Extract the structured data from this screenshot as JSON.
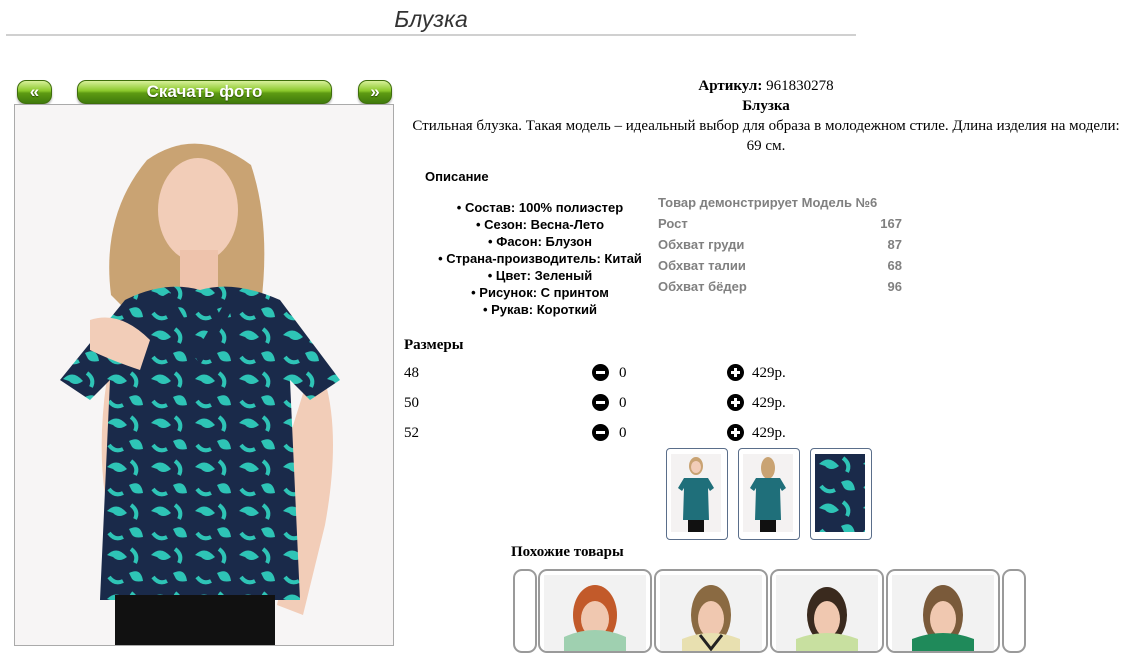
{
  "page": {
    "title": "Блузка"
  },
  "gallery": {
    "prev_label": "«",
    "download_label": "Скачать фото",
    "next_label": "»",
    "thumbnails": [
      "front-view",
      "back-view",
      "fabric-pattern"
    ]
  },
  "product": {
    "article_label": "Артикул:",
    "article_value": "961830278",
    "name": "Блузка",
    "description": "Стильная блузка. Такая модель – идеальный выбор для образа в молодежном стиле. Длина изделия на модели: 69 см."
  },
  "description_section": {
    "heading": "Описание",
    "items": [
      "Состав: 100% полиэстер",
      "Сезон: Весна-Лето",
      "Фасон: Блузон",
      "Страна-производитель: Китай",
      "Цвет: Зеленый",
      "Рисунок: С принтом",
      "Рукав: Короткий"
    ]
  },
  "model_params": {
    "heading": "Товар демонстрирует Модель №6",
    "rows": [
      {
        "label": "Рост",
        "value": "167"
      },
      {
        "label": "Обхват груди",
        "value": "87"
      },
      {
        "label": "Обхват талии",
        "value": "68"
      },
      {
        "label": "Обхват бёдер",
        "value": "96"
      }
    ]
  },
  "sizes": {
    "heading": "Размеры",
    "rows": [
      {
        "size": "48",
        "qty": "0",
        "price": "429р."
      },
      {
        "size": "50",
        "qty": "0",
        "price": "429р."
      },
      {
        "size": "52",
        "qty": "0",
        "price": "429р."
      }
    ]
  },
  "similar": {
    "heading": "Похожие товары"
  },
  "colors": {
    "button_green": "#6aa81a",
    "print_teal": "#2ec4b6",
    "print_navy": "#1a2a4a"
  }
}
